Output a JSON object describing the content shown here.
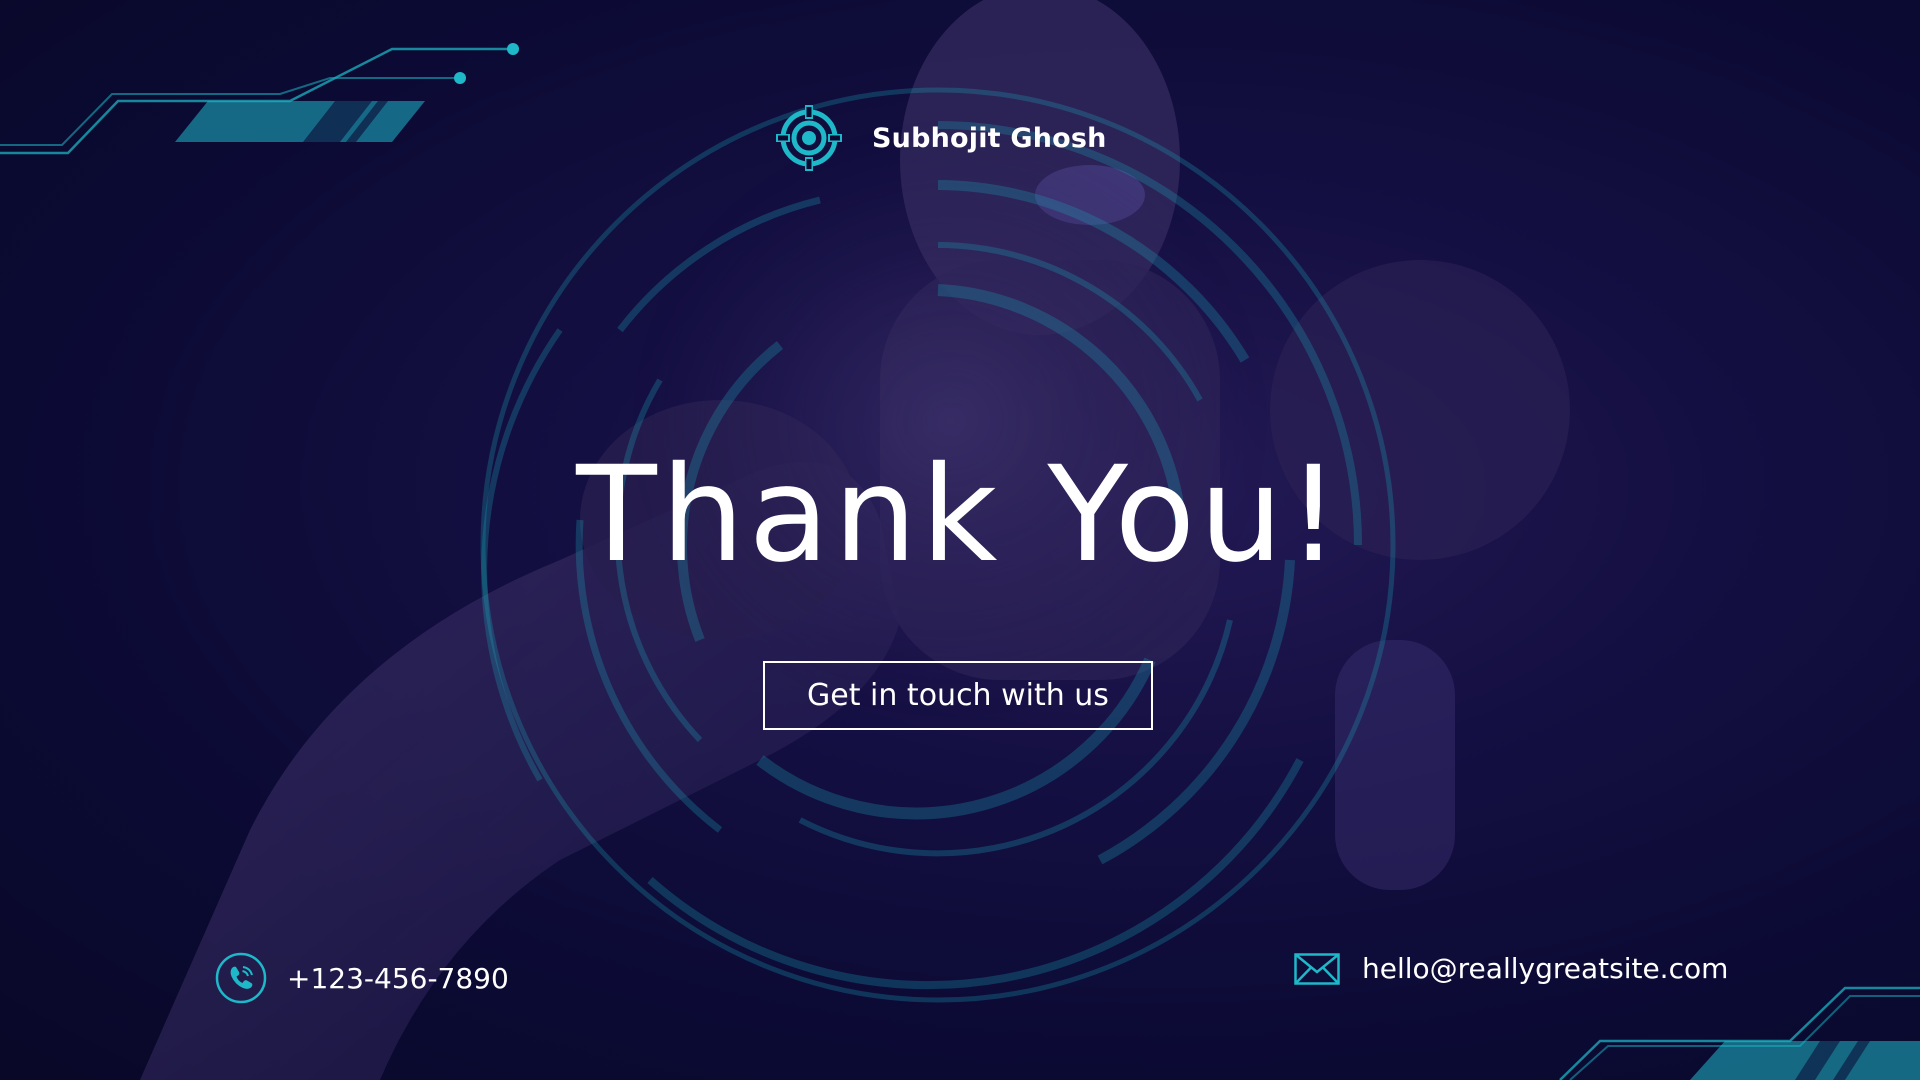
{
  "brand": {
    "name": "Subhojit Ghosh",
    "logo_icon": "target-crosshair-icon"
  },
  "headline": "Thank You!",
  "cta": {
    "label": "Get in touch with us"
  },
  "contact": {
    "phone": "+123-456-7890",
    "phone_icon": "phone-icon",
    "email": "hello@reallygreatsite.com",
    "email_icon": "envelope-icon"
  },
  "colors": {
    "background": "#0b0a33",
    "accent": "#1fb8c9",
    "text": "#ffffff"
  }
}
